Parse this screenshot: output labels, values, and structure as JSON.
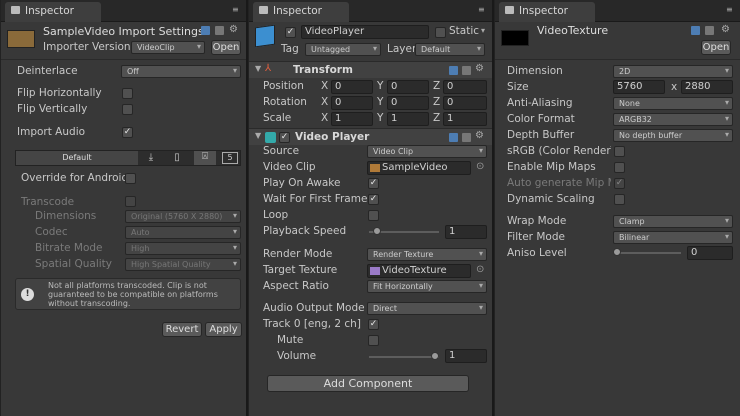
{
  "panel1": {
    "tab": "Inspector",
    "title": "SampleVideo Import Settings",
    "importer_version_label": "Importer Version",
    "importer_version_value": "VideoClip",
    "open_label": "Open",
    "deinterlace_label": "Deinterlace",
    "deinterlace_value": "Off",
    "flip_h_label": "Flip Horizontally",
    "flip_v_label": "Flip Vertically",
    "import_audio_label": "Import Audio",
    "platform_default": "Default",
    "override_label": "Override for Android",
    "transcode_label": "Transcode",
    "dimensions_label": "Dimensions",
    "dimensions_value": "Original (5760 X 2880)",
    "codec_label": "Codec",
    "codec_value": "Auto",
    "bitrate_label": "Bitrate Mode",
    "bitrate_value": "High",
    "spatial_label": "Spatial Quality",
    "spatial_value": "High Spatial Quality",
    "warning": "Not all platforms transcoded. Clip is not guaranteed to be compatible on platforms without transcoding.",
    "revert_label": "Revert",
    "apply_label": "Apply"
  },
  "panel2": {
    "tab": "Inspector",
    "object_name": "VideoPlayer",
    "static_label": "Static",
    "tag_label": "Tag",
    "tag_value": "Untagged",
    "layer_label": "Layer",
    "layer_value": "Default",
    "transform_title": "Transform",
    "position_label": "Position",
    "rotation_label": "Rotation",
    "scale_label": "Scale",
    "axis_x": "X",
    "axis_y": "Y",
    "axis_z": "Z",
    "pos": [
      "0",
      "0",
      "0"
    ],
    "rot": [
      "0",
      "0",
      "0"
    ],
    "scl": [
      "1",
      "1",
      "1"
    ],
    "videoplayer_title": "Video Player",
    "source_label": "Source",
    "source_value": "Video Clip",
    "videoclip_label": "Video Clip",
    "videoclip_value": "SampleVideo",
    "playonawake_label": "Play On Awake",
    "waitfirst_label": "Wait For First Frame",
    "loop_label": "Loop",
    "playback_label": "Playback Speed",
    "playback_value": "1",
    "render_label": "Render Mode",
    "render_value": "Render Texture",
    "target_label": "Target Texture",
    "target_value": "VideoTexture",
    "aspect_label": "Aspect Ratio",
    "aspect_value": "Fit Horizontally",
    "audio_label": "Audio Output Mode",
    "audio_value": "Direct",
    "track_label": "Track 0 [eng, 2 ch]",
    "mute_label": "Mute",
    "volume_label": "Volume",
    "volume_value": "1",
    "add_component_label": "Add Component"
  },
  "panel3": {
    "tab": "Inspector",
    "title": "VideoTexture",
    "open_label": "Open",
    "dimension_label": "Dimension",
    "dimension_value": "2D",
    "size_label": "Size",
    "size_w": "5760",
    "size_x": "x",
    "size_h": "2880",
    "aa_label": "Anti-Aliasing",
    "aa_value": "None",
    "colorformat_label": "Color Format",
    "colorformat_value": "ARGB32",
    "depth_label": "Depth Buffer",
    "depth_value": "No depth buffer",
    "srgb_label": "sRGB (Color RenderTe",
    "mip_label": "Enable Mip Maps",
    "automip_label": "Auto generate Mip Ma",
    "dynamic_label": "Dynamic Scaling",
    "wrap_label": "Wrap Mode",
    "wrap_value": "Clamp",
    "filter_label": "Filter Mode",
    "filter_value": "Bilinear",
    "aniso_label": "Aniso Level",
    "aniso_value": "0"
  },
  "checks": {
    "mark": "✓"
  }
}
